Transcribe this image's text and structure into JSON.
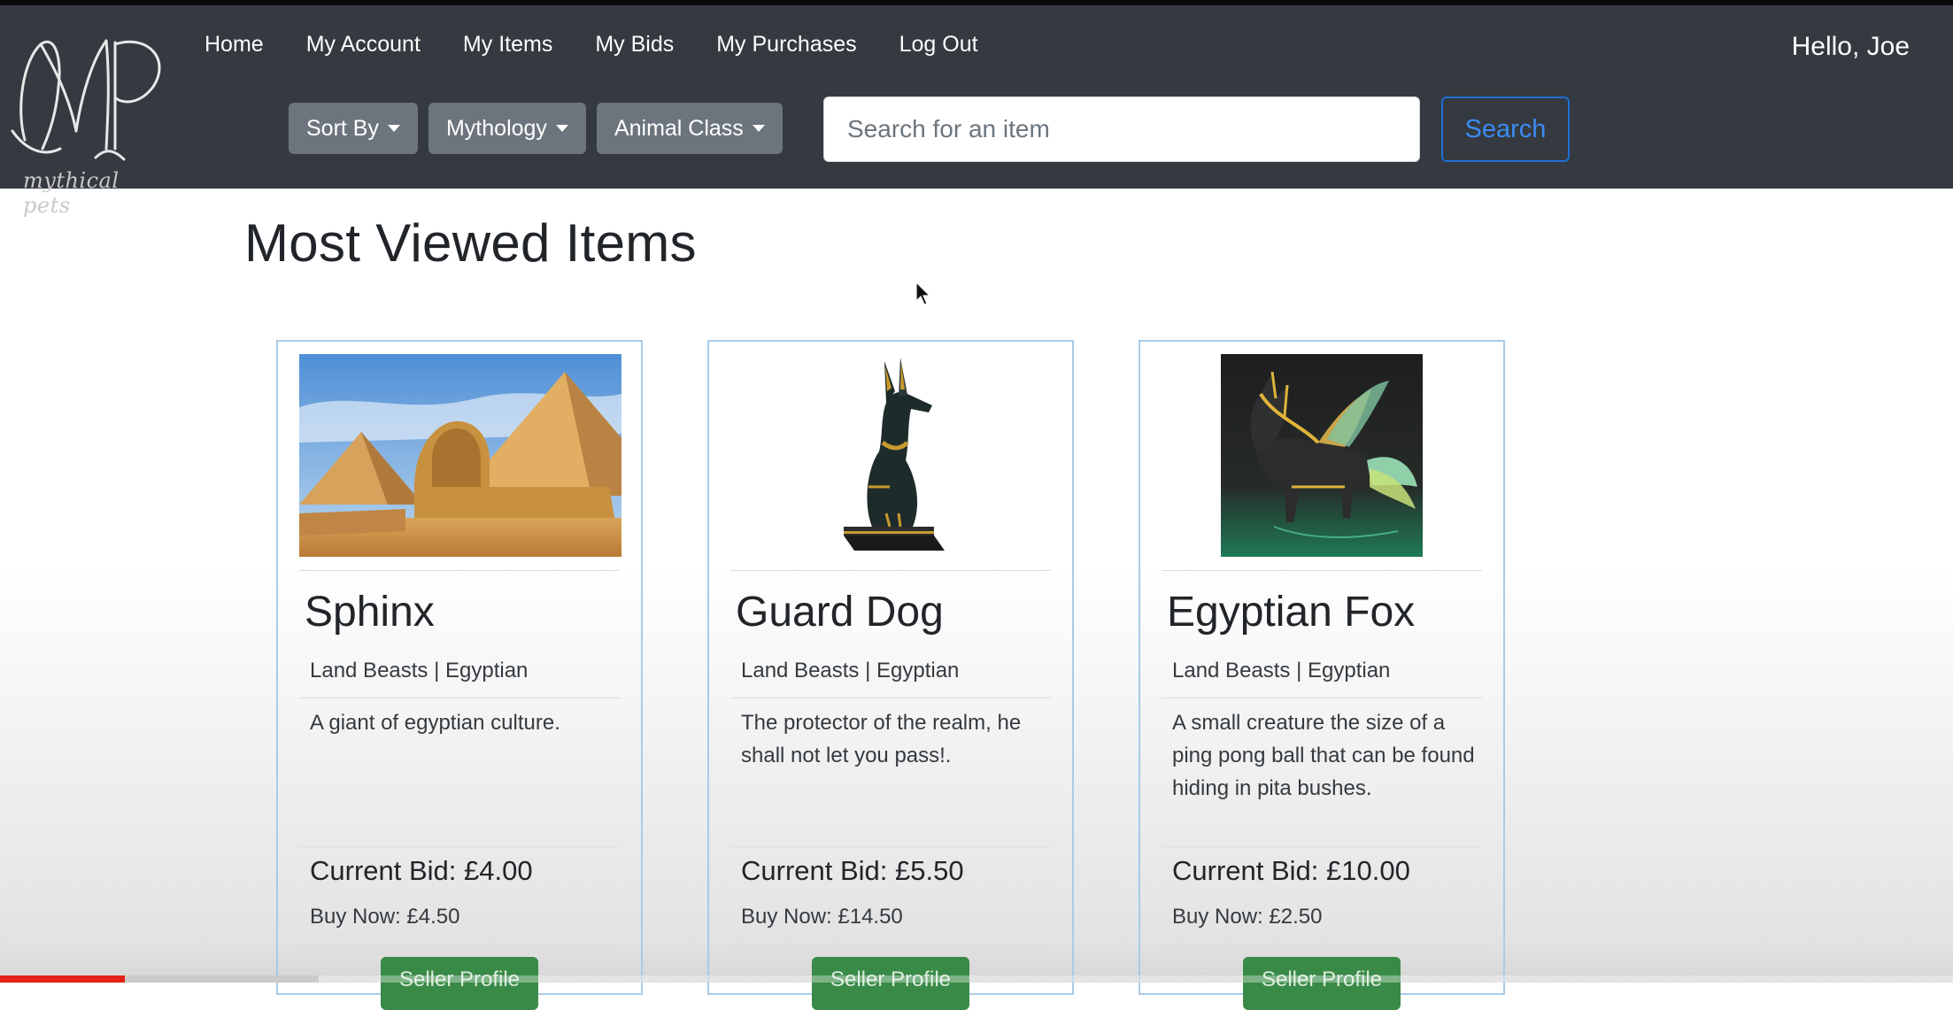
{
  "navbar": {
    "logo_monogram": "MP",
    "logo_subtitle": "mythical pets",
    "links": [
      "Home",
      "My Account",
      "My Items",
      "My Bids",
      "My Purchases",
      "Log Out"
    ],
    "greeting": "Hello, Joe",
    "filters": [
      "Sort By",
      "Mythology",
      "Animal Class"
    ],
    "search_placeholder": "Search for an item",
    "search_button": "Search"
  },
  "main": {
    "heading": "Most Viewed Items",
    "cards": [
      {
        "name": "Sphinx",
        "category": "Land Beasts | Egyptian",
        "description": "A giant of egyptian culture.",
        "current_bid": "Current Bid: £4.00",
        "buy_now": "Buy Now: £4.50",
        "seller_button": "Seller Profile"
      },
      {
        "name": "Guard Dog",
        "category": "Land Beasts | Egyptian",
        "description": "The protector of the realm, he shall not let you pass!.",
        "current_bid": "Current Bid: £5.50",
        "buy_now": "Buy Now: £14.50",
        "seller_button": "Seller Profile"
      },
      {
        "name": "Egyptian Fox",
        "category": "Land Beasts | Egyptian",
        "description": "A small creature the size of a ping pong ball that can be found hiding in pita bushes.",
        "current_bid": "Current Bid: £10.00",
        "buy_now": "Buy Now: £2.50",
        "seller_button": "Seller Profile"
      }
    ]
  },
  "video_progress": {
    "played_fraction": 0.064,
    "buffered_fraction": 0.163
  },
  "colors": {
    "navbar": "#343a40",
    "dropdown": "#6c757d",
    "search_outline": "#1f6ed4",
    "card_border": "#a9cbe7",
    "seller_button": "#3a8a47",
    "progress_played": "#e62117"
  }
}
